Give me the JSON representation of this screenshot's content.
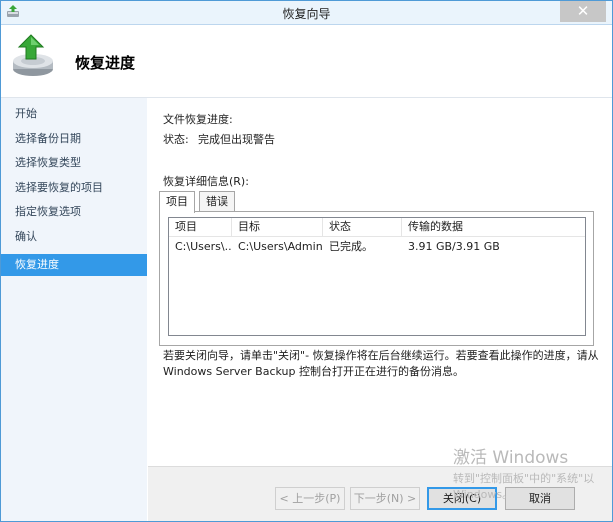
{
  "window": {
    "title": "恢复向导",
    "close_glyph": "✕"
  },
  "header": {
    "title": "恢复进度",
    "icon": "backup-restore-icon"
  },
  "sidebar": {
    "items": [
      {
        "label": "开始"
      },
      {
        "label": "选择备份日期"
      },
      {
        "label": "选择恢复类型"
      },
      {
        "label": "选择要恢复的项目"
      },
      {
        "label": "指定恢复选项"
      },
      {
        "label": "确认"
      },
      {
        "label": "恢复进度",
        "active": true
      }
    ]
  },
  "main": {
    "section_label": "文件恢复进度:",
    "status_label": "状态:",
    "status_value": "完成但出现警告",
    "details_label": "恢复详细信息(R):",
    "tabs": [
      {
        "label": "项目",
        "active": true
      },
      {
        "label": "错误"
      }
    ],
    "table": {
      "columns": [
        "项目",
        "目标",
        "状态",
        "传输的数据"
      ],
      "rows": [
        [
          "C:\\Users\\...",
          "C:\\Users\\Admin...",
          "已完成。",
          "3.91 GB/3.91 GB"
        ]
      ]
    },
    "info_line1": "若要关闭向导，请单击\"关闭\"- 恢复操作将在后台继续运行。若要查看此操作的进度，请从",
    "info_line2": "Windows Server Backup 控制台打开正在进行的备份消息。"
  },
  "footer": {
    "prev_label": "< 上一步(P)",
    "next_label": "下一步(N) >",
    "close_label": "关闭(C)",
    "cancel_label": "取消"
  },
  "watermark": {
    "line1": "激活 Windows",
    "line2": "转到\"控制面板\"中的\"系统\"以",
    "line3": "Windows。"
  },
  "colors": {
    "accent": "#3399e8",
    "sidebar_bg": "#f0f5fb",
    "titlebar_bg": "#eaf4fc"
  }
}
